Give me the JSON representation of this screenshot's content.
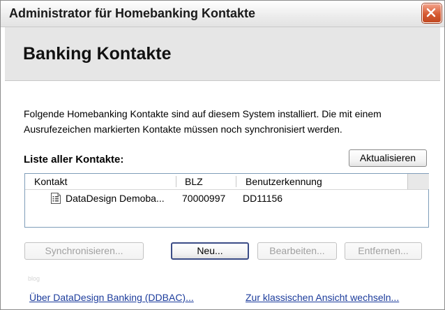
{
  "window": {
    "title": "Administrator für Homebanking Kontakte"
  },
  "header": {
    "title": "Banking Kontakte"
  },
  "description": "Folgende Homebanking Kontakte sind auf diesem System installiert. Die mit einem Ausrufezeichen markierten Kontakte müssen noch synchronisiert werden.",
  "list": {
    "label": "Liste aller Kontakte:",
    "refresh_label": "Aktualisieren",
    "columns": [
      "Kontakt",
      "BLZ",
      "Benutzerkennung"
    ],
    "rows": [
      {
        "icon": "document-icon",
        "kontakt": "DataDesign Demoba...",
        "blz": "70000997",
        "benutzerkennung": "DD11156"
      }
    ]
  },
  "actions": {
    "sync_label": "Synchronisieren...",
    "new_label": "Neu...",
    "edit_label": "Bearbeiten...",
    "remove_label": "Entfernen..."
  },
  "watermark": "blog",
  "links": {
    "about": "Über DataDesign Banking (DDBAC)...",
    "classic_view": "Zur klassischen Ansicht wechseln..."
  },
  "colors": {
    "link": "#1c3c9c",
    "close_button": "#d65a32",
    "header_band": "#e6e6e6"
  }
}
